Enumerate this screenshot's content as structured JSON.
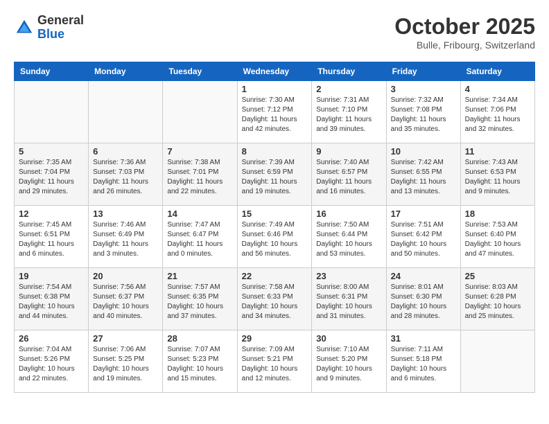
{
  "logo": {
    "general": "General",
    "blue": "Blue"
  },
  "header": {
    "month_year": "October 2025",
    "location": "Bulle, Fribourg, Switzerland"
  },
  "days_of_week": [
    "Sunday",
    "Monday",
    "Tuesday",
    "Wednesday",
    "Thursday",
    "Friday",
    "Saturday"
  ],
  "weeks": [
    [
      {
        "day": "",
        "info": ""
      },
      {
        "day": "",
        "info": ""
      },
      {
        "day": "",
        "info": ""
      },
      {
        "day": "1",
        "info": "Sunrise: 7:30 AM\nSunset: 7:12 PM\nDaylight: 11 hours\nand 42 minutes."
      },
      {
        "day": "2",
        "info": "Sunrise: 7:31 AM\nSunset: 7:10 PM\nDaylight: 11 hours\nand 39 minutes."
      },
      {
        "day": "3",
        "info": "Sunrise: 7:32 AM\nSunset: 7:08 PM\nDaylight: 11 hours\nand 35 minutes."
      },
      {
        "day": "4",
        "info": "Sunrise: 7:34 AM\nSunset: 7:06 PM\nDaylight: 11 hours\nand 32 minutes."
      }
    ],
    [
      {
        "day": "5",
        "info": "Sunrise: 7:35 AM\nSunset: 7:04 PM\nDaylight: 11 hours\nand 29 minutes."
      },
      {
        "day": "6",
        "info": "Sunrise: 7:36 AM\nSunset: 7:03 PM\nDaylight: 11 hours\nand 26 minutes."
      },
      {
        "day": "7",
        "info": "Sunrise: 7:38 AM\nSunset: 7:01 PM\nDaylight: 11 hours\nand 22 minutes."
      },
      {
        "day": "8",
        "info": "Sunrise: 7:39 AM\nSunset: 6:59 PM\nDaylight: 11 hours\nand 19 minutes."
      },
      {
        "day": "9",
        "info": "Sunrise: 7:40 AM\nSunset: 6:57 PM\nDaylight: 11 hours\nand 16 minutes."
      },
      {
        "day": "10",
        "info": "Sunrise: 7:42 AM\nSunset: 6:55 PM\nDaylight: 11 hours\nand 13 minutes."
      },
      {
        "day": "11",
        "info": "Sunrise: 7:43 AM\nSunset: 6:53 PM\nDaylight: 11 hours\nand 9 minutes."
      }
    ],
    [
      {
        "day": "12",
        "info": "Sunrise: 7:45 AM\nSunset: 6:51 PM\nDaylight: 11 hours\nand 6 minutes."
      },
      {
        "day": "13",
        "info": "Sunrise: 7:46 AM\nSunset: 6:49 PM\nDaylight: 11 hours\nand 3 minutes."
      },
      {
        "day": "14",
        "info": "Sunrise: 7:47 AM\nSunset: 6:47 PM\nDaylight: 11 hours\nand 0 minutes."
      },
      {
        "day": "15",
        "info": "Sunrise: 7:49 AM\nSunset: 6:46 PM\nDaylight: 10 hours\nand 56 minutes."
      },
      {
        "day": "16",
        "info": "Sunrise: 7:50 AM\nSunset: 6:44 PM\nDaylight: 10 hours\nand 53 minutes."
      },
      {
        "day": "17",
        "info": "Sunrise: 7:51 AM\nSunset: 6:42 PM\nDaylight: 10 hours\nand 50 minutes."
      },
      {
        "day": "18",
        "info": "Sunrise: 7:53 AM\nSunset: 6:40 PM\nDaylight: 10 hours\nand 47 minutes."
      }
    ],
    [
      {
        "day": "19",
        "info": "Sunrise: 7:54 AM\nSunset: 6:38 PM\nDaylight: 10 hours\nand 44 minutes."
      },
      {
        "day": "20",
        "info": "Sunrise: 7:56 AM\nSunset: 6:37 PM\nDaylight: 10 hours\nand 40 minutes."
      },
      {
        "day": "21",
        "info": "Sunrise: 7:57 AM\nSunset: 6:35 PM\nDaylight: 10 hours\nand 37 minutes."
      },
      {
        "day": "22",
        "info": "Sunrise: 7:58 AM\nSunset: 6:33 PM\nDaylight: 10 hours\nand 34 minutes."
      },
      {
        "day": "23",
        "info": "Sunrise: 8:00 AM\nSunset: 6:31 PM\nDaylight: 10 hours\nand 31 minutes."
      },
      {
        "day": "24",
        "info": "Sunrise: 8:01 AM\nSunset: 6:30 PM\nDaylight: 10 hours\nand 28 minutes."
      },
      {
        "day": "25",
        "info": "Sunrise: 8:03 AM\nSunset: 6:28 PM\nDaylight: 10 hours\nand 25 minutes."
      }
    ],
    [
      {
        "day": "26",
        "info": "Sunrise: 7:04 AM\nSunset: 5:26 PM\nDaylight: 10 hours\nand 22 minutes."
      },
      {
        "day": "27",
        "info": "Sunrise: 7:06 AM\nSunset: 5:25 PM\nDaylight: 10 hours\nand 19 minutes."
      },
      {
        "day": "28",
        "info": "Sunrise: 7:07 AM\nSunset: 5:23 PM\nDaylight: 10 hours\nand 15 minutes."
      },
      {
        "day": "29",
        "info": "Sunrise: 7:09 AM\nSunset: 5:21 PM\nDaylight: 10 hours\nand 12 minutes."
      },
      {
        "day": "30",
        "info": "Sunrise: 7:10 AM\nSunset: 5:20 PM\nDaylight: 10 hours\nand 9 minutes."
      },
      {
        "day": "31",
        "info": "Sunrise: 7:11 AM\nSunset: 5:18 PM\nDaylight: 10 hours\nand 6 minutes."
      },
      {
        "day": "",
        "info": ""
      }
    ]
  ]
}
